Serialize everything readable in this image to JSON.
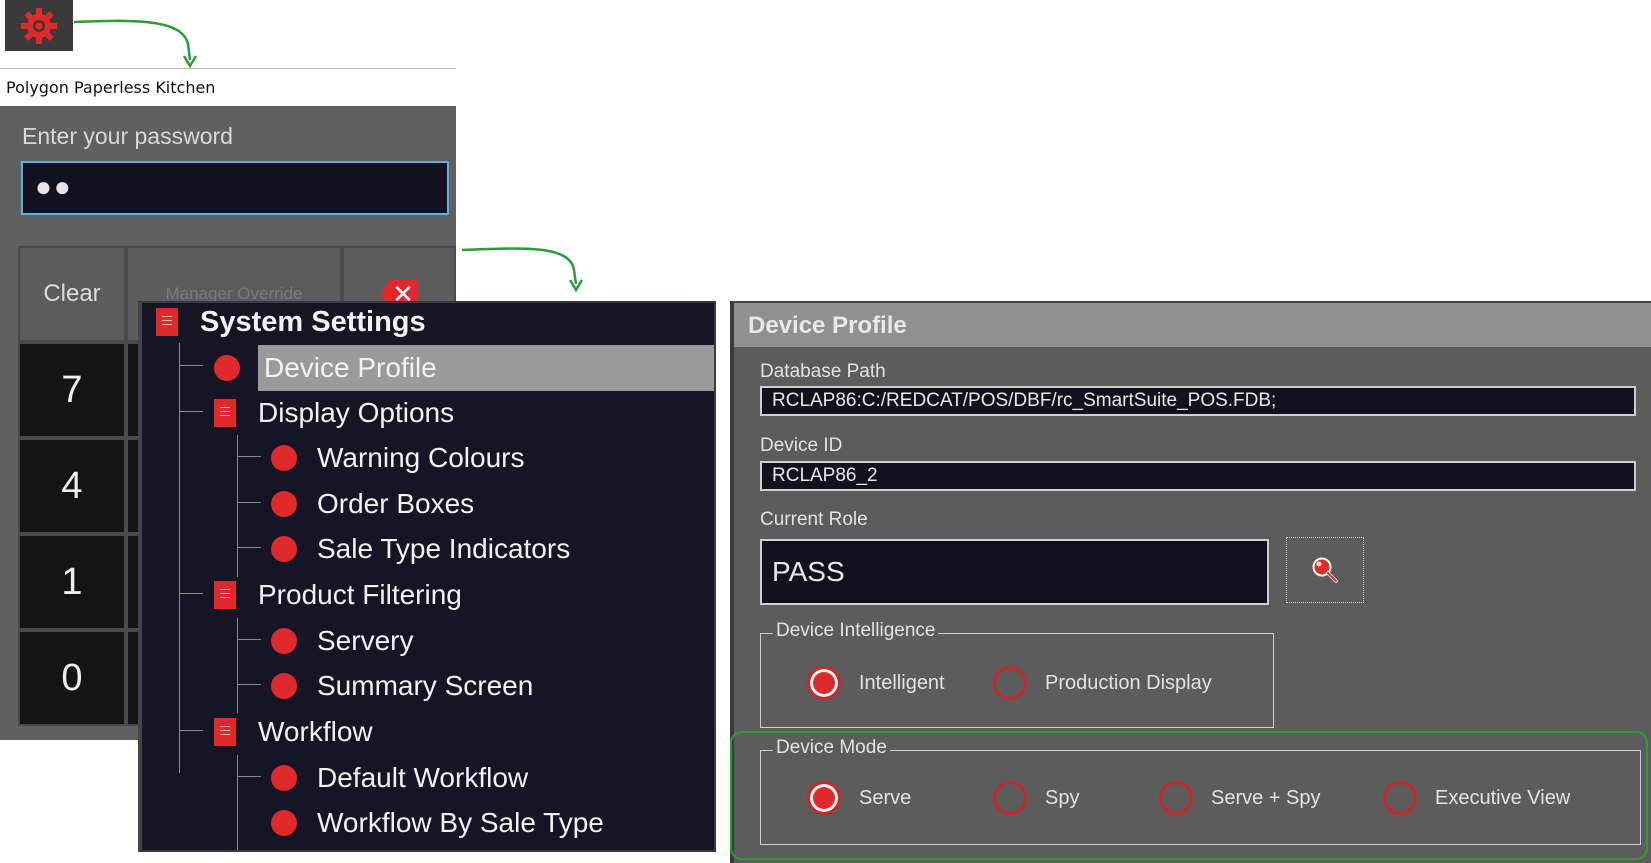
{
  "login": {
    "window_title": "Polygon Paperless Kitchen",
    "password_label": "Enter your password",
    "password_value": "●●",
    "keys": {
      "clear": "Clear",
      "manager_override": "Manager Override",
      "seven": "7",
      "four": "4",
      "one": "1",
      "zero": "0"
    }
  },
  "tree": {
    "root": "System Settings",
    "device_profile": "Device Profile",
    "display_options": "Display Options",
    "warning_colours": "Warning Colours",
    "order_boxes": "Order Boxes",
    "sale_type_indicators": "Sale Type Indicators",
    "product_filtering": "Product Filtering",
    "servery": "Servery",
    "summary_screen": "Summary Screen",
    "workflow": "Workflow",
    "default_workflow": "Default Workflow",
    "workflow_by_sale_type": "Workflow By Sale Type"
  },
  "profile": {
    "header": "Device Profile",
    "database_path_label": "Database Path",
    "database_path_value": "RCLAP86:C:/REDCAT/POS/DBF/rc_SmartSuite_POS.FDB;",
    "device_id_label": "Device ID",
    "device_id_value": "RCLAP86_2",
    "current_role_label": "Current Role",
    "current_role_value": "PASS",
    "intelligence": {
      "title": "Device Intelligence",
      "options": [
        "Intelligent",
        "Production Display"
      ],
      "selected": "Intelligent"
    },
    "mode": {
      "title": "Device Mode",
      "options": [
        "Serve",
        "Spy",
        "Serve + Spy",
        "Executive View"
      ],
      "selected": "Serve"
    }
  },
  "colors": {
    "accent_red": "#e0292a",
    "highlight_green": "#2e9a3a",
    "focus_blue": "#5ab0e8"
  }
}
